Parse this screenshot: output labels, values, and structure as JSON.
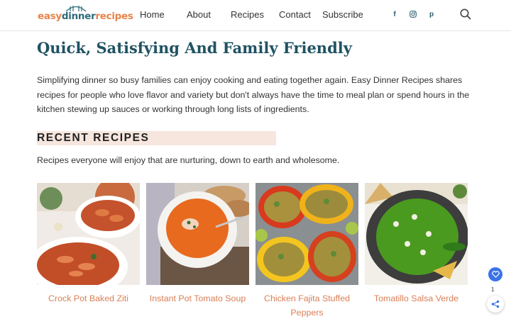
{
  "header": {
    "logo": {
      "part1": "easy",
      "part2": "dinner",
      "part3": "recipes"
    },
    "nav": [
      "Home",
      "About",
      "Recipes",
      "Contact",
      "Subscribe"
    ],
    "social": {
      "facebook": "f",
      "instagram": "◎",
      "pinterest": "p"
    }
  },
  "main": {
    "title": "Quick, Satisfying And Family Friendly",
    "intro": "Simplifying dinner so busy families can enjoy cooking and eating together again. Easy Dinner Recipes shares recipes for people who love flavor and variety but don't always have the time to meal plan or spend hours in the kitchen stewing up sauces or working through long lists of ingredients.",
    "section_heading": "RECENT RECIPES",
    "section_sub": "Recipes everyone will enjoy that are nurturing, down to earth and wholesome.",
    "recipes": [
      {
        "title": "Crock Pot Baked Ziti"
      },
      {
        "title": "Instant Pot Tomato Soup"
      },
      {
        "title": "Chicken Fajita Stuffed Peppers"
      },
      {
        "title": "Tomatillo Salsa Verde"
      }
    ]
  },
  "widgets": {
    "share_count": "1"
  },
  "colors": {
    "accent": "#d97f55",
    "title": "#1f5263",
    "highlight": "#f6e6de"
  }
}
